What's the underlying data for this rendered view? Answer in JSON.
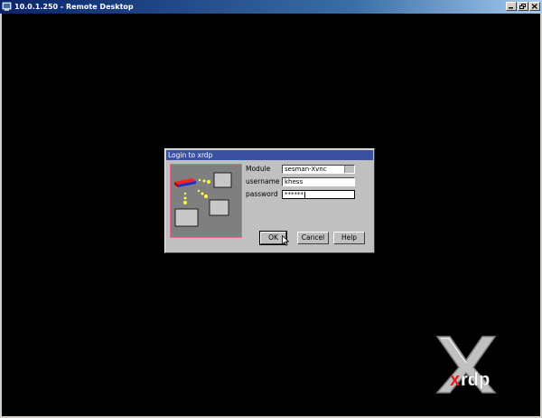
{
  "window": {
    "title": "10.0.1.250 - Remote Desktop",
    "controls": [
      "minimize",
      "restore",
      "close"
    ]
  },
  "dialog": {
    "title": "Login to xrdp",
    "fields": {
      "module_label": "Module",
      "module_value": "sesman-Xvnc",
      "username_label": "username",
      "username_value": "khess",
      "password_label": "password",
      "password_value": "******"
    },
    "buttons": {
      "ok": "OK",
      "cancel": "Cancel",
      "help": "Help"
    }
  },
  "colors": {
    "desktop": "#000000",
    "titlebar_start": "#0a246a",
    "dialog_bg": "#c0c0c0",
    "dialog_title": "#3a50a0",
    "banner_bg": "#7f7f7f"
  },
  "logo": {
    "text_x": "x",
    "text_rdp": "rdp"
  }
}
